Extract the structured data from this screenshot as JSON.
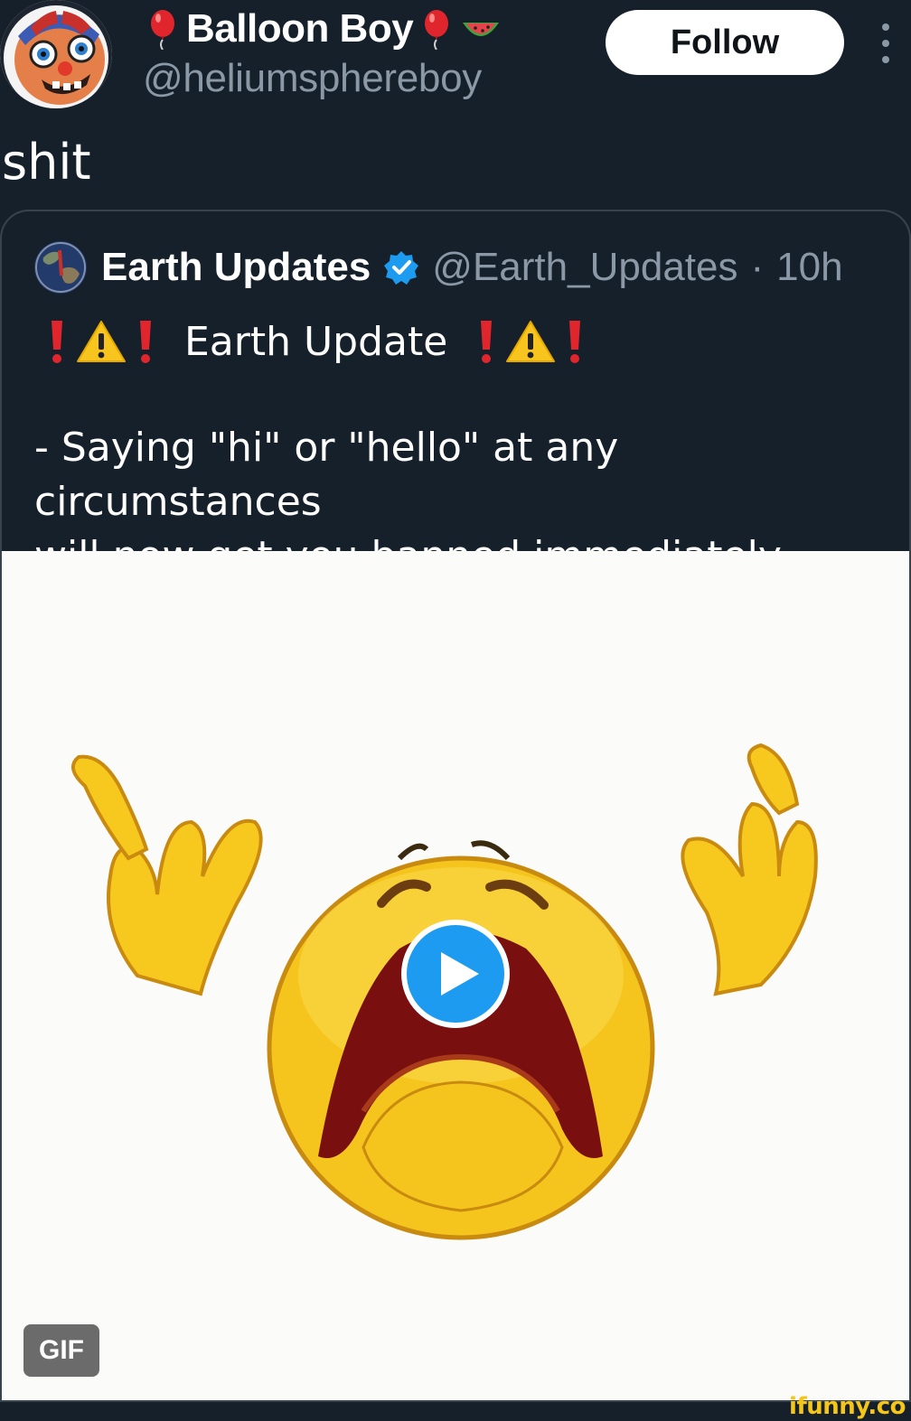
{
  "author": {
    "display_name": "Balloon Boy",
    "handle": "@heliumsphereboy",
    "name_icons": [
      "balloon-icon",
      "balloon-icon",
      "watermelon-icon"
    ],
    "avatar_icon": "balloon-boy-avatar"
  },
  "actions": {
    "follow_label": "Follow",
    "more_icon": "more-vertical-icon"
  },
  "tweet": {
    "text": "shit"
  },
  "quote": {
    "name": "Earth Updates",
    "verified": true,
    "handle": "@Earth_Updates",
    "separator": "·",
    "time": "10h",
    "title": "Earth Update",
    "title_icons": [
      "exclamation-icon",
      "warning-icon",
      "exclamation-icon"
    ],
    "body": "- Saying \"hi\" or \"hello\" at any circumstances\nwill now get you banned immediately",
    "media": {
      "type": "gif",
      "badge": "GIF",
      "description_icon": "crying-emoji-icon"
    }
  },
  "watermark": "ifunny.co",
  "colors": {
    "background": "#15202b",
    "accent": "#1d9bf0",
    "muted_text": "#8b98a5",
    "border": "#38444d"
  }
}
